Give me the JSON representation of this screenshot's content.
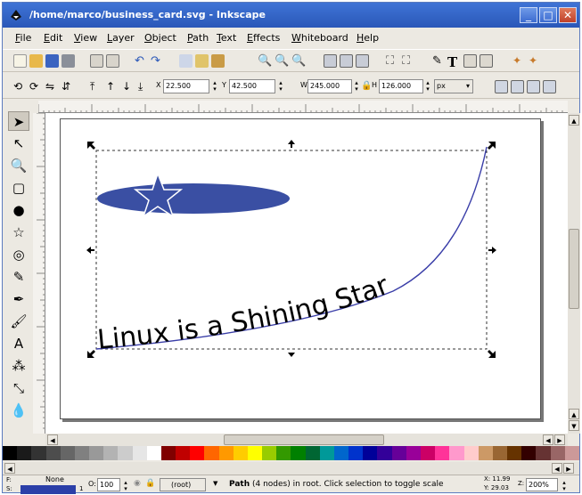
{
  "window": {
    "title": "/home/marco/business_card.svg - Inkscape",
    "accent": "#2a57b8",
    "buttons": {
      "minimize": "_",
      "maximize": "□",
      "close": "✕"
    }
  },
  "menu": [
    "File",
    "Edit",
    "View",
    "Layer",
    "Object",
    "Path",
    "Text",
    "Effects",
    "Whiteboard",
    "Help"
  ],
  "toolcontrols": {
    "x_label": "X",
    "x_value": "22.500",
    "y_label": "Y",
    "y_value": "42.500",
    "w_label": "W",
    "w_value": "245.000",
    "h_label": "H",
    "h_value": "126.000",
    "unit": "px"
  },
  "toolbox": [
    {
      "name": "selector-tool-icon",
      "glyph": "➤"
    },
    {
      "name": "node-tool-icon",
      "glyph": "↖"
    },
    {
      "name": "zoom-tool-icon",
      "glyph": "🔍"
    },
    {
      "name": "rect-tool-icon",
      "glyph": "▢"
    },
    {
      "name": "ellipse-tool-icon",
      "glyph": "●"
    },
    {
      "name": "star-tool-icon",
      "glyph": "☆"
    },
    {
      "name": "spiral-tool-icon",
      "glyph": "◎"
    },
    {
      "name": "pencil-tool-icon",
      "glyph": "✎"
    },
    {
      "name": "pen-tool-icon",
      "glyph": "✒"
    },
    {
      "name": "calligraphy-tool-icon",
      "glyph": "🖌"
    },
    {
      "name": "text-tool-icon",
      "glyph": "A"
    },
    {
      "name": "spray-tool-icon",
      "glyph": "⁂"
    },
    {
      "name": "connector-tool-icon",
      "glyph": "⤡"
    },
    {
      "name": "dropper-tool-icon",
      "glyph": "💧"
    }
  ],
  "canvas": {
    "curve_text": "Linux is a Shining Star",
    "star_color": "#3a4fa3",
    "path_color": "#3a3ea8"
  },
  "palette": [
    "#000000",
    "#1a1a1a",
    "#333333",
    "#4d4d4d",
    "#666666",
    "#808080",
    "#999999",
    "#b3b3b3",
    "#cccccc",
    "#e6e6e6",
    "#ffffff",
    "#800000",
    "#c00000",
    "#ff0000",
    "#ff6600",
    "#ff9900",
    "#ffcc00",
    "#ffff00",
    "#99cc00",
    "#339900",
    "#008000",
    "#006633",
    "#009999",
    "#0066cc",
    "#0033cc",
    "#000099",
    "#330099",
    "#660099",
    "#990099",
    "#cc0066",
    "#ff3399",
    "#ff99cc",
    "#ffcccc",
    "#cc9966",
    "#996633",
    "#663300",
    "#330000",
    "#663333",
    "#996666",
    "#cc9999"
  ],
  "status": {
    "fill_label": "F:",
    "fill_value": "None",
    "stroke_label": "S:",
    "stroke_color": "#2b3fa8",
    "stroke_width": "1",
    "opacity_label": "O:",
    "opacity_value": "100",
    "layer": "(root)",
    "message_bold": "Path",
    "message": " (4 nodes) in root. Click selection to toggle scale",
    "x_coord": "X: 11.99",
    "y_coord": "Y: 29.03",
    "zoom_label": "Z:",
    "zoom": "200%"
  }
}
